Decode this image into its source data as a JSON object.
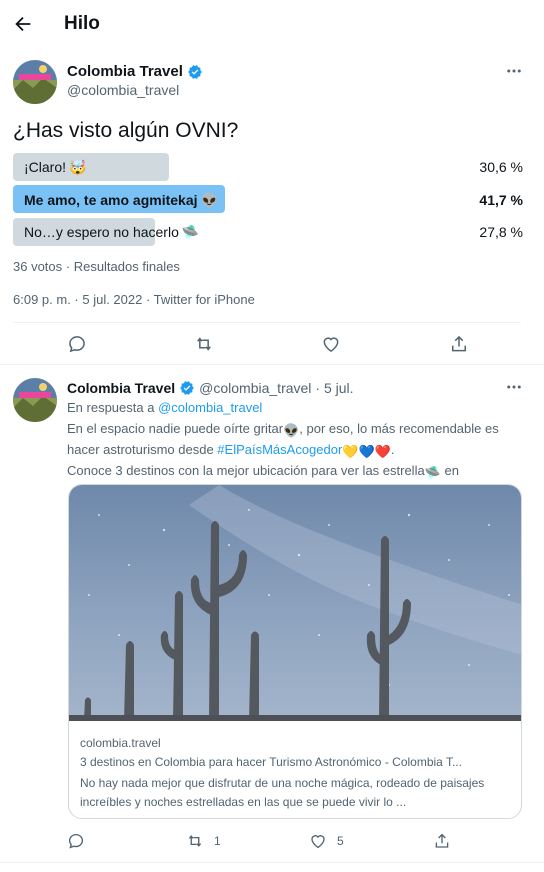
{
  "header": {
    "title": "Hilo"
  },
  "tweet": {
    "author_name": "Colombia Travel",
    "author_handle": "@colombia_travel",
    "text": "¿Has visto algún OVNI?",
    "poll": {
      "options": [
        {
          "label": "¡Claro!",
          "emoji": "🤯",
          "percent_text": "30,6 %",
          "percent": 30.6,
          "winner": false
        },
        {
          "label": "Me amo, te amo agmitekaj",
          "emoji": "👽",
          "percent_text": "41,7 %",
          "percent": 41.7,
          "winner": true
        },
        {
          "label": "No…y espero no hacerlo",
          "emoji": "🛸",
          "percent_text": "27,8 %",
          "percent": 27.8,
          "winner": false
        }
      ],
      "meta": "36 votos · Resultados finales"
    },
    "timestamp": "6:09 p. m. · 5 jul. 2022 · Twitter for iPhone"
  },
  "reply": {
    "author_name": "Colombia Travel",
    "author_handle": "@colombia_travel",
    "date": "· 5 jul.",
    "replying_prefix": "En respuesta a",
    "replying_to": "@colombia_travel",
    "text_1": "En el espacio nadie puede oírte gritar",
    "text_2": ", por eso, lo más recomendable es hacer astroturismo desde ",
    "hashtag": "#ElPaísMásAcogedor",
    "text_3": ".",
    "text_4": "Conoce 3 destinos con la mejor ubicación para ver las estrella",
    "text_5": " en",
    "card": {
      "domain": "colombia.travel",
      "title": "3 destinos en Colombia para hacer Turismo Astronómico - Colombia T...",
      "description": "No hay nada mejor que disfrutar de una noche mágica, rodeado de paisajes increíbles y noches estrelladas en las que se puede vivir lo ..."
    },
    "retweet_count": "1",
    "like_count": "5"
  },
  "colors": {
    "accent": "#1d9bf0",
    "poll_winner": "#7ac2f5",
    "poll_other": "#cfd9de",
    "text_secondary": "#536471"
  }
}
